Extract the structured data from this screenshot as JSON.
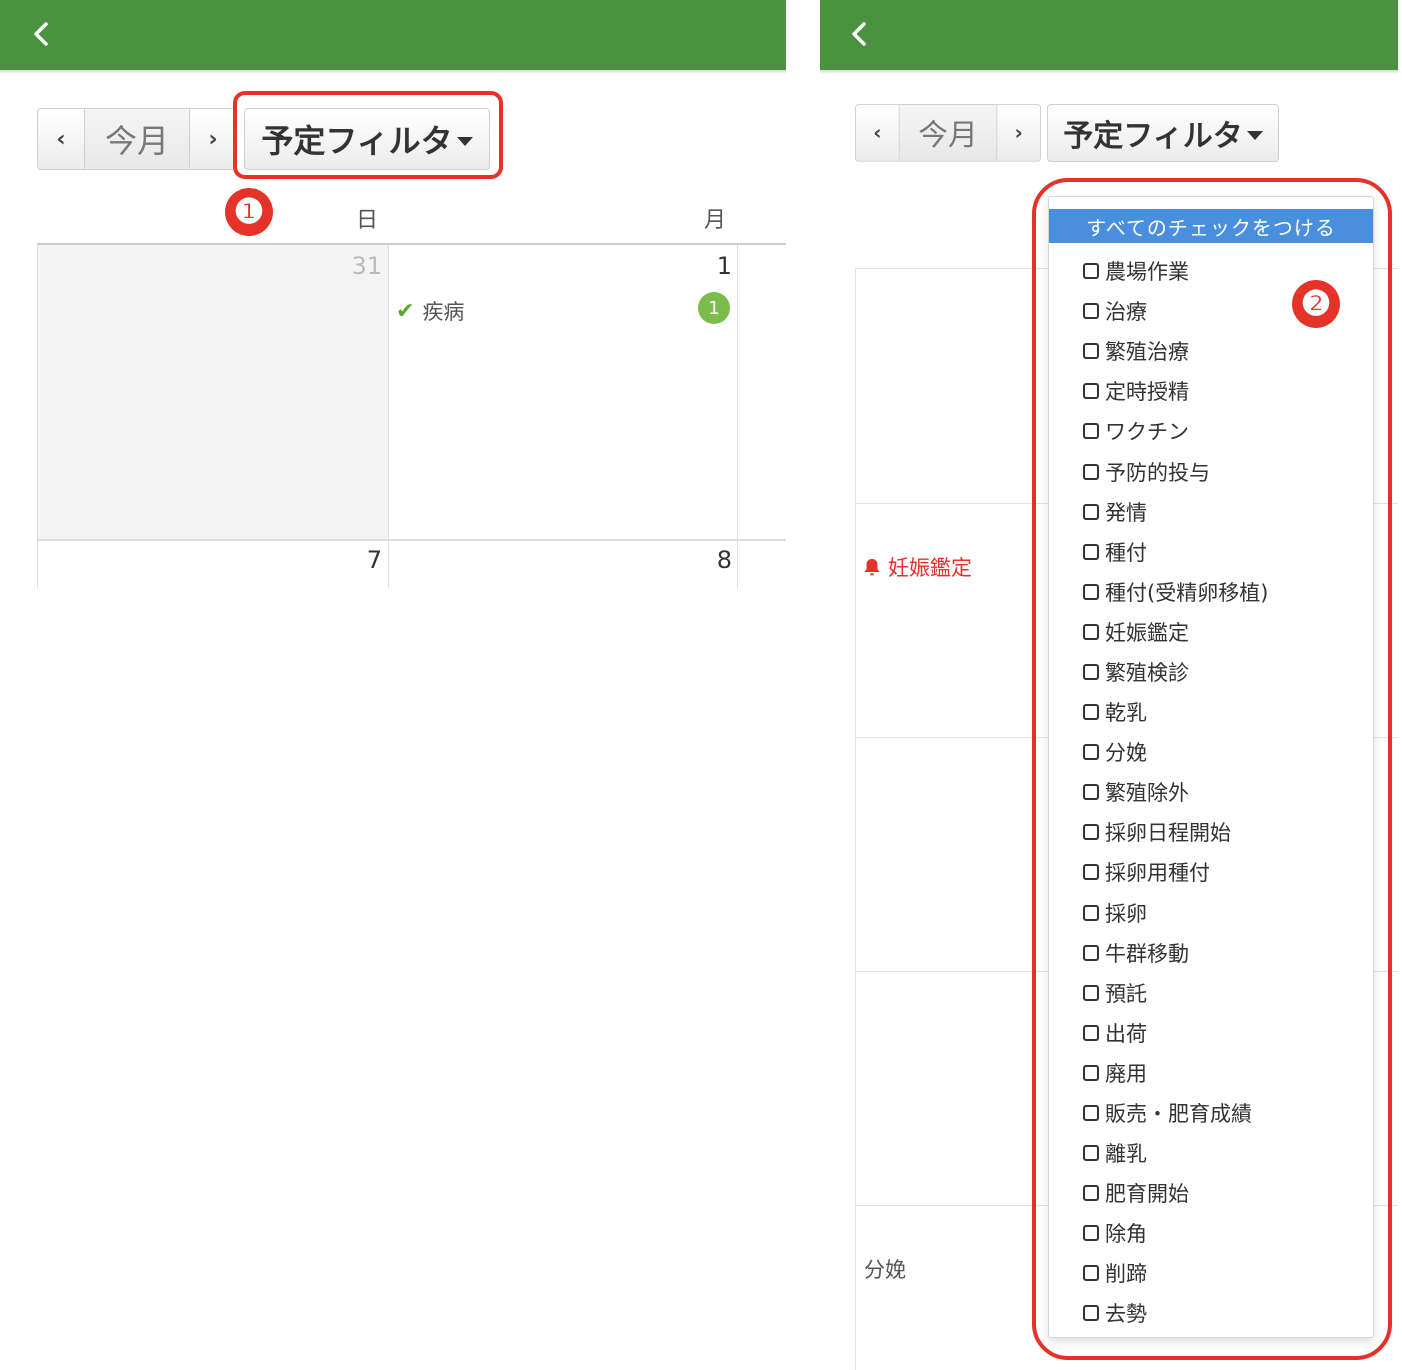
{
  "colors": {
    "header": "#4a9240",
    "accent_red": "#e5332a",
    "select_all_bg": "#4a8fdd",
    "check_green": "#5aa831"
  },
  "left": {
    "back_icon": "chevron-left-icon",
    "nav": {
      "prev": "‹",
      "today": "今月",
      "next": "›"
    },
    "filter_label": "予定フィルタ",
    "step_badge": "❶",
    "weekdays": [
      "日",
      "月"
    ],
    "days": {
      "d31": "31",
      "d1": "1",
      "d7": "7",
      "d8": "8"
    },
    "event": {
      "label": "疾病",
      "count": "1"
    }
  },
  "right": {
    "back_icon": "chevron-left-icon",
    "nav": {
      "prev": "‹",
      "today": "今月",
      "next": "›"
    },
    "filter_label": "予定フィルタ",
    "step_badge": "❷",
    "bg_events": {
      "pregnancy": "妊娠鑑定",
      "calving": "分娩"
    },
    "select_all": "すべてのチェックをつける",
    "items": [
      "農場作業",
      "治療",
      "繁殖治療",
      "定時授精",
      "ワクチン",
      "予防的投与",
      "発情",
      "種付",
      "種付(受精卵移植)",
      "妊娠鑑定",
      "繁殖検診",
      "乾乳",
      "分娩",
      "繁殖除外",
      "採卵日程開始",
      "採卵用種付",
      "採卵",
      "牛群移動",
      "預託",
      "出荷",
      "廃用",
      "販売・肥育成績",
      "離乳",
      "肥育開始",
      "除角",
      "削蹄",
      "去勢"
    ]
  }
}
